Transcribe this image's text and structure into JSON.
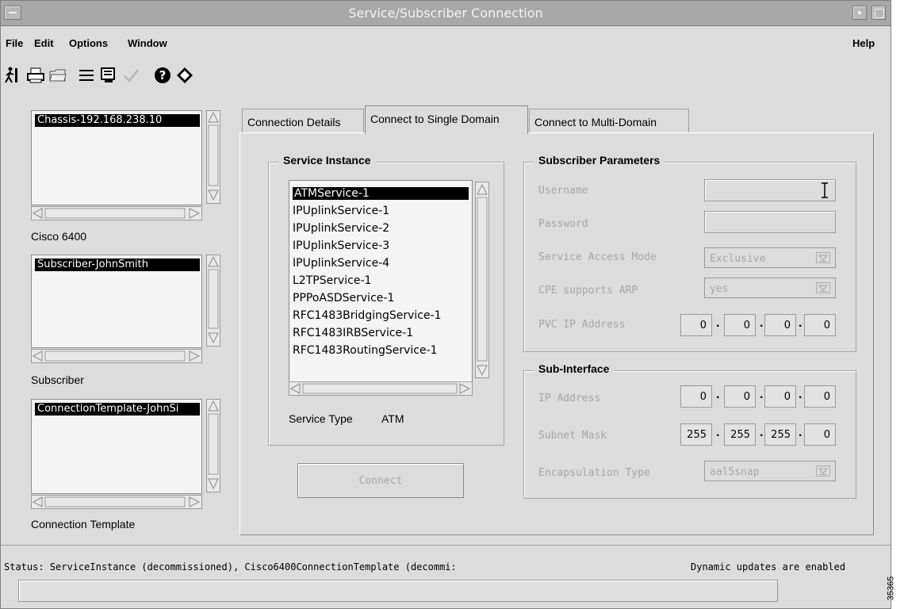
{
  "window": {
    "title": "Service/Subscriber Connection"
  },
  "menu": {
    "file": "File",
    "edit": "Edit",
    "options": "Options",
    "window": "Window",
    "help": "Help"
  },
  "toolbar": {
    "icons": [
      "exit-icon",
      "print-icon",
      "open-folder-icon",
      "list-icon",
      "window-icon",
      "check-icon",
      "help-icon",
      "diamond-icon"
    ]
  },
  "left": {
    "chassis": {
      "item": "Chassis-192.168.238.10",
      "label": "Cisco 6400"
    },
    "subscriber": {
      "item": "Subscriber-JohnSmith",
      "label": "Subscriber"
    },
    "template": {
      "item": "ConnectionTemplate-JohnSi",
      "label": "Connection Template"
    }
  },
  "tabs": [
    {
      "label": "Connection Details"
    },
    {
      "label": "Connect to Single Domain"
    },
    {
      "label": "Connect to Multi-Domain"
    }
  ],
  "service_instance": {
    "title": "Service Instance",
    "items": [
      "ATMService-1",
      "IPUplinkService-1",
      "IPUplinkService-2",
      "IPUplinkService-3",
      "IPUplinkService-4",
      "L2TPService-1",
      "PPPoASDService-1",
      "RFC1483BridgingService-1",
      "RFC1483IRBService-1",
      "RFC1483RoutingService-1"
    ],
    "service_type_label": "Service Type",
    "service_type_value": "ATM"
  },
  "connect_button": "Connect",
  "subscriber_params": {
    "title": "Subscriber Parameters",
    "username_label": "Username",
    "password_label": "Password",
    "access_mode_label": "Service Access Mode",
    "access_mode_value": "Exclusive",
    "cpe_arp_label": "CPE supports ARP",
    "cpe_arp_value": "yes",
    "pvc_ip_label": "PVC IP Address",
    "pvc_ip": [
      "0",
      "0",
      "0",
      "0"
    ]
  },
  "sub_interface": {
    "title": "Sub-Interface",
    "ip_label": "IP Address",
    "ip": [
      "0",
      "0",
      "0",
      "0"
    ],
    "mask_label": "Subnet Mask",
    "mask": [
      "255",
      "255",
      "255",
      "0"
    ],
    "encap_label": "Encapsulation Type",
    "encap_value": "aal5snap"
  },
  "status": {
    "text": "Status: ServiceInstance (decommissioned), Cisco6400ConnectionTemplate (decommi:",
    "dynamic": "Dynamic updates are enabled"
  },
  "figure_number": "35365",
  "colors": {
    "selection": "#000000",
    "disabled_text": "#a8a8a8",
    "background": "#dcdcdc"
  }
}
